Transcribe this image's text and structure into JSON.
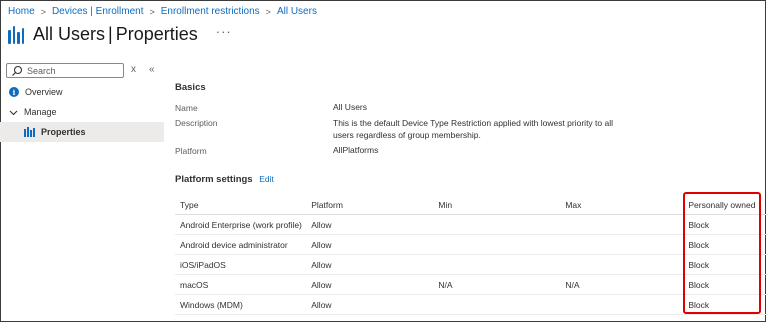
{
  "breadcrumb": [
    "Home",
    "Devices | Enrollment",
    "Enrollment restrictions",
    "All Users"
  ],
  "header": {
    "title": "All Users",
    "subtitle": "Properties",
    "more_label": "···"
  },
  "sidebar": {
    "search_placeholder": "Search",
    "collapse_label": "«",
    "close_label": "x",
    "items": [
      {
        "label": "Overview",
        "icon": "info-icon"
      },
      {
        "label": "Manage",
        "icon": "chevron-down-icon"
      },
      {
        "label": "Properties",
        "icon": "properties-icon",
        "selected": true
      }
    ]
  },
  "basics": {
    "heading": "Basics",
    "rows": [
      {
        "label": "Name",
        "value": "All Users"
      },
      {
        "label": "Description",
        "value": "This is the default Device Type Restriction applied with lowest priority to all users regardless of group membership."
      },
      {
        "label": "Platform",
        "value": "AllPlatforms"
      }
    ]
  },
  "platform_settings": {
    "heading": "Platform settings",
    "edit_label": "Edit",
    "columns": [
      "Type",
      "Platform",
      "Min",
      "Max",
      "Personally owned"
    ],
    "rows": [
      [
        "Android Enterprise (work profile)",
        "Allow",
        "",
        "",
        "Block"
      ],
      [
        "Android device administrator",
        "Allow",
        "",
        "",
        "Block"
      ],
      [
        "iOS/iPadOS",
        "Allow",
        "",
        "",
        "Block"
      ],
      [
        "macOS",
        "Allow",
        "N/A",
        "N/A",
        "Block"
      ],
      [
        "Windows (MDM)",
        "Allow",
        "",
        "",
        "Block"
      ]
    ]
  },
  "colors": {
    "accent": "#0f6cbd",
    "highlight": "#e00000",
    "selected_bg": "#edebe9"
  }
}
